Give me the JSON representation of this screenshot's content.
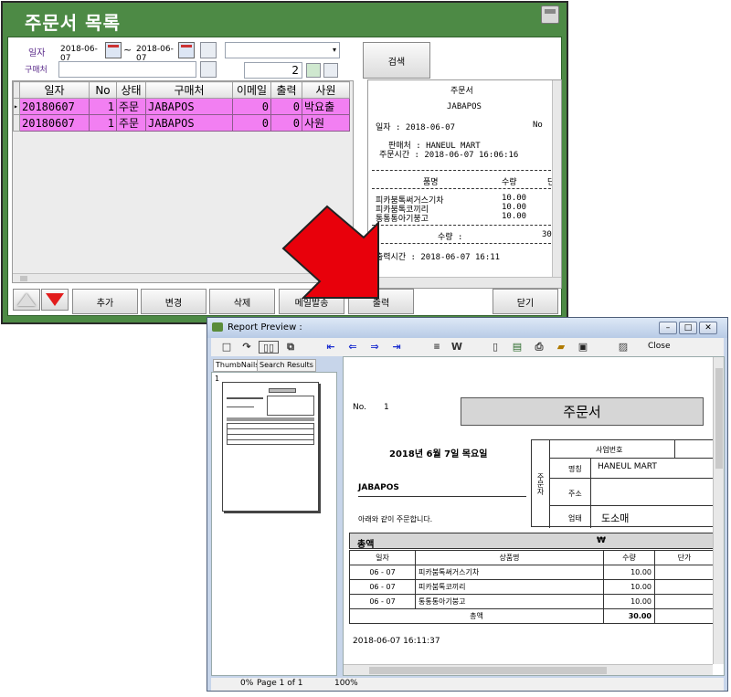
{
  "list_window": {
    "title": "주문서 목록",
    "date_label": "일자",
    "buyer_label": "구매처",
    "date_from": "2018-06-07",
    "tilde": "~",
    "date_to": "2018-06-07",
    "count": "2",
    "search_button": "검색",
    "grid": {
      "columns": [
        "일자",
        "No",
        "상태",
        "구매처",
        "이메일",
        "출력",
        "사원"
      ],
      "rows": [
        [
          "20180607",
          "1",
          "주문",
          "JABAPOS",
          "0",
          "0",
          "박요출"
        ],
        [
          "20180607",
          "1",
          "주문",
          "JABAPOS",
          "0",
          "0",
          "사원"
        ]
      ]
    },
    "receipt": {
      "title": "주문서",
      "company": "JABAPOS",
      "date_line": "일자 : 2018-06-07",
      "no_label": "No",
      "seller_line": "판매처 : HANEUL MART",
      "order_time_line": "주문시간 : 2018-06-07 16:06:16",
      "col_item": "품명",
      "col_qty": "수량",
      "col_price": "단",
      "items": [
        {
          "name": "피카붐톡써거스기차",
          "qty": "10.00"
        },
        {
          "name": "피카붐톡코끼리",
          "qty": "10.00"
        },
        {
          "name": "통통통아기붕고",
          "qty": "10.00"
        }
      ],
      "qty_total_label": "수량 :",
      "qty_total_value": "30",
      "print_time_line": "출력시간 : 2018-06-07 16:11"
    },
    "buttons": {
      "add": "추가",
      "edit": "변경",
      "delete": "삭제",
      "mail": "메일발송",
      "print": "출력",
      "close": "닫기"
    }
  },
  "preview_window": {
    "title": "Report Preview :",
    "close_label": "Close",
    "tabs": [
      "ThumbNails",
      "Search Results"
    ],
    "thumb_number": "1",
    "status": {
      "progress": "0%",
      "page": "Page 1 of 1",
      "zoom": "100%"
    },
    "report": {
      "no_label": "No.",
      "no_value": "1",
      "title": "주문서",
      "date": "2018년 6월 7일 목요일",
      "buyer": "JABAPOS",
      "message": "아래와 같이 주문합니다.",
      "supplier_side_label": "주문자",
      "supplier_fields": [
        {
          "label": "사업번호",
          "value": ""
        },
        {
          "label": "명칭",
          "value": "HANEUL MART"
        },
        {
          "label": "주소",
          "value": ""
        },
        {
          "label": "업태",
          "value": "도소매"
        }
      ],
      "total_label": "총액",
      "currency": "₩",
      "columns": [
        "일자",
        "상품명",
        "수량",
        "단가"
      ],
      "items": [
        {
          "date": "06 - 07",
          "name": "피카붐톡써거스기차",
          "qty": "10.00"
        },
        {
          "date": "06 - 07",
          "name": "피카붐톡코끼리",
          "qty": "10.00"
        },
        {
          "date": "06 - 07",
          "name": "통통통아기붕고",
          "qty": "10.00"
        }
      ],
      "sum_label": "총액",
      "sum_qty": "30.00",
      "footer_time": "2018-06-07 16:11:37"
    }
  },
  "colors": {
    "window_green": "#4d8a45",
    "row_highlight": "#f27ff2",
    "arrow_red": "#e8000b",
    "preview_blue": "#c7d5ea"
  }
}
